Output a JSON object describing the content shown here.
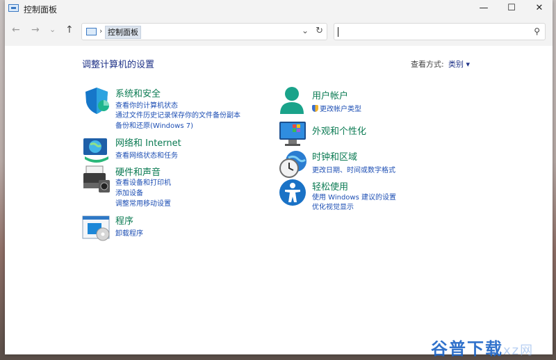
{
  "window": {
    "title": "控制面板"
  },
  "title_controls": {
    "minimize": "—",
    "maximize": "☐",
    "close": "✕"
  },
  "nav": {
    "back": "←",
    "forward": "→",
    "recent": "⌄",
    "up": "↑"
  },
  "address": {
    "separator": "›",
    "crumb": "控制面板",
    "dropdown": "⌄",
    "refresh": "↻"
  },
  "search": {
    "icon": "⚲"
  },
  "content": {
    "page_title": "调整计算机的设置",
    "view_by_label": "查看方式:",
    "view_by_value": "类别 ▾"
  },
  "categories": [
    {
      "title": "系统和安全",
      "links": [
        "查看你的计算机状态",
        "通过文件历史记录保存你的文件备份副本",
        "备份和还原(Windows 7)"
      ]
    },
    {
      "title": "网络和 Internet",
      "links": [
        "查看网络状态和任务"
      ]
    },
    {
      "title": "硬件和声音",
      "links": [
        "查看设备和打印机",
        "添加设备",
        "调整常用移动设置"
      ]
    },
    {
      "title": "程序",
      "links": [
        "卸载程序"
      ]
    },
    {
      "title": "用户帐户",
      "links": [
        "更改帐户类型"
      ]
    },
    {
      "title": "外观和个性化",
      "links": []
    },
    {
      "title": "时钟和区域",
      "links": [
        "更改日期、时间或数字格式"
      ]
    },
    {
      "title": "轻松使用",
      "links": [
        "使用 Windows 建议的设置",
        "优化视觉显示"
      ]
    }
  ],
  "watermark": {
    "main": "谷普下载",
    "sub": "xz网"
  },
  "colors": {
    "link": "#1e4fb4",
    "category_title": "#0a7a52",
    "heading": "#1e3287"
  }
}
